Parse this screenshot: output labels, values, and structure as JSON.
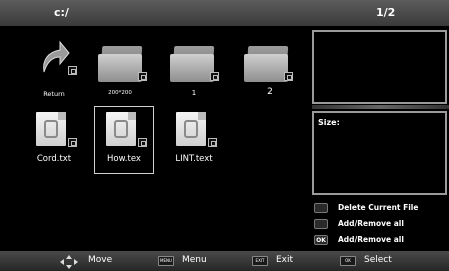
{
  "header": {
    "path": "c:/",
    "page": "1/2"
  },
  "items": [
    {
      "label": "Return",
      "type": "return"
    },
    {
      "label": "200*200",
      "type": "folder"
    },
    {
      "label": "1",
      "type": "folder"
    },
    {
      "label": "2",
      "type": "folder"
    },
    {
      "label": "Cord.txt",
      "type": "file"
    },
    {
      "label": "How.tex",
      "type": "file",
      "selected": true
    },
    {
      "label": "LINT.text",
      "type": "file"
    }
  ],
  "info": {
    "size_label": "Size:"
  },
  "legend": [
    {
      "key": "",
      "text": "Delete Current File"
    },
    {
      "key": "",
      "text": "Add/Remove all"
    },
    {
      "key": "OK",
      "text": "Add/Remove all"
    }
  ],
  "footer": [
    {
      "key": "move-icon",
      "text": "Move"
    },
    {
      "key": "MENU",
      "text": "Menu"
    },
    {
      "key": "EXIT",
      "text": "Exit"
    },
    {
      "key": "OK",
      "text": "Select"
    }
  ]
}
